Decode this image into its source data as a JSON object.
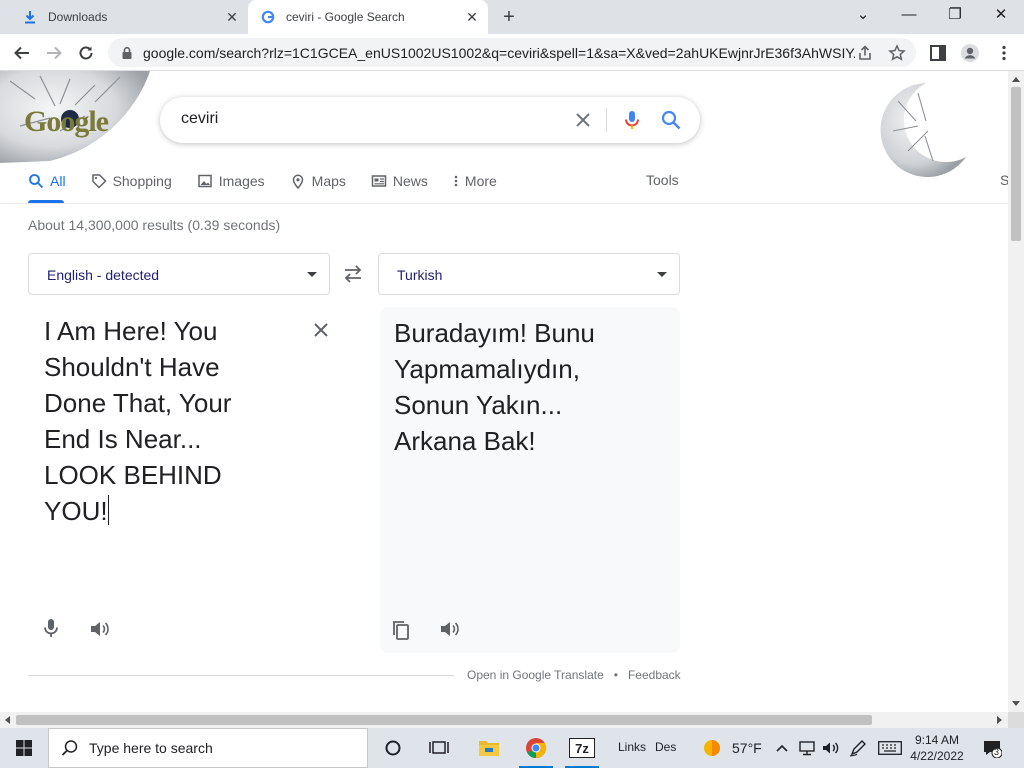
{
  "browser": {
    "tabs": [
      {
        "title": "Downloads",
        "icon": "download-icon",
        "active": false
      },
      {
        "title": "ceviri - Google Search",
        "icon": "google-icon",
        "active": true
      }
    ],
    "new_tab_icon": "plus-icon",
    "window_controls": [
      "minimize",
      "restore",
      "close"
    ],
    "url": "google.com/search?rlz=1C1GCEA_enUS1002US1002&q=ceviri&spell=1&sa=X&ved=2ahUKEwjnrJrE36f3AhWSIY..."
  },
  "search": {
    "logo_text": "Google",
    "query": "ceviri",
    "tabs": [
      {
        "label": "All",
        "icon": "search-icon",
        "active": true
      },
      {
        "label": "Shopping",
        "icon": "tag-icon",
        "active": false
      },
      {
        "label": "Images",
        "icon": "image-icon",
        "active": false
      },
      {
        "label": "Maps",
        "icon": "map-pin-icon",
        "active": false
      },
      {
        "label": "News",
        "icon": "news-icon",
        "active": false
      },
      {
        "label": "More",
        "icon": "more-vert-icon",
        "active": false
      }
    ],
    "tools_label": "Tools",
    "cut_label": "S",
    "result_stats": "About 14,300,000 results (0.39 seconds)"
  },
  "translate": {
    "source_lang": "English - detected",
    "target_lang": "Turkish",
    "source_lines": [
      "I Am Here! You",
      "Shouldn't Have",
      "Done That, Your",
      "End Is Near...",
      "LOOK BEHIND",
      "YOU!"
    ],
    "target_lines": [
      "Buradayım! Bunu",
      "Yapmamalıydın,",
      "Sonun Yakın...",
      "Arkana Bak!"
    ],
    "open_in_translate": "Open in Google Translate",
    "separator": "•",
    "feedback": "Feedback"
  },
  "taskbar": {
    "search_placeholder": "Type here to search",
    "links_label": "Links",
    "des_label": "Des",
    "temperature": "57°F",
    "time": "9:14 AM",
    "date": "4/22/2022",
    "notification_count": "3"
  },
  "colors": {
    "accent": "#1a73e8",
    "tabstrip": "#dee1e6",
    "taskbar": "#dfe3ea"
  }
}
